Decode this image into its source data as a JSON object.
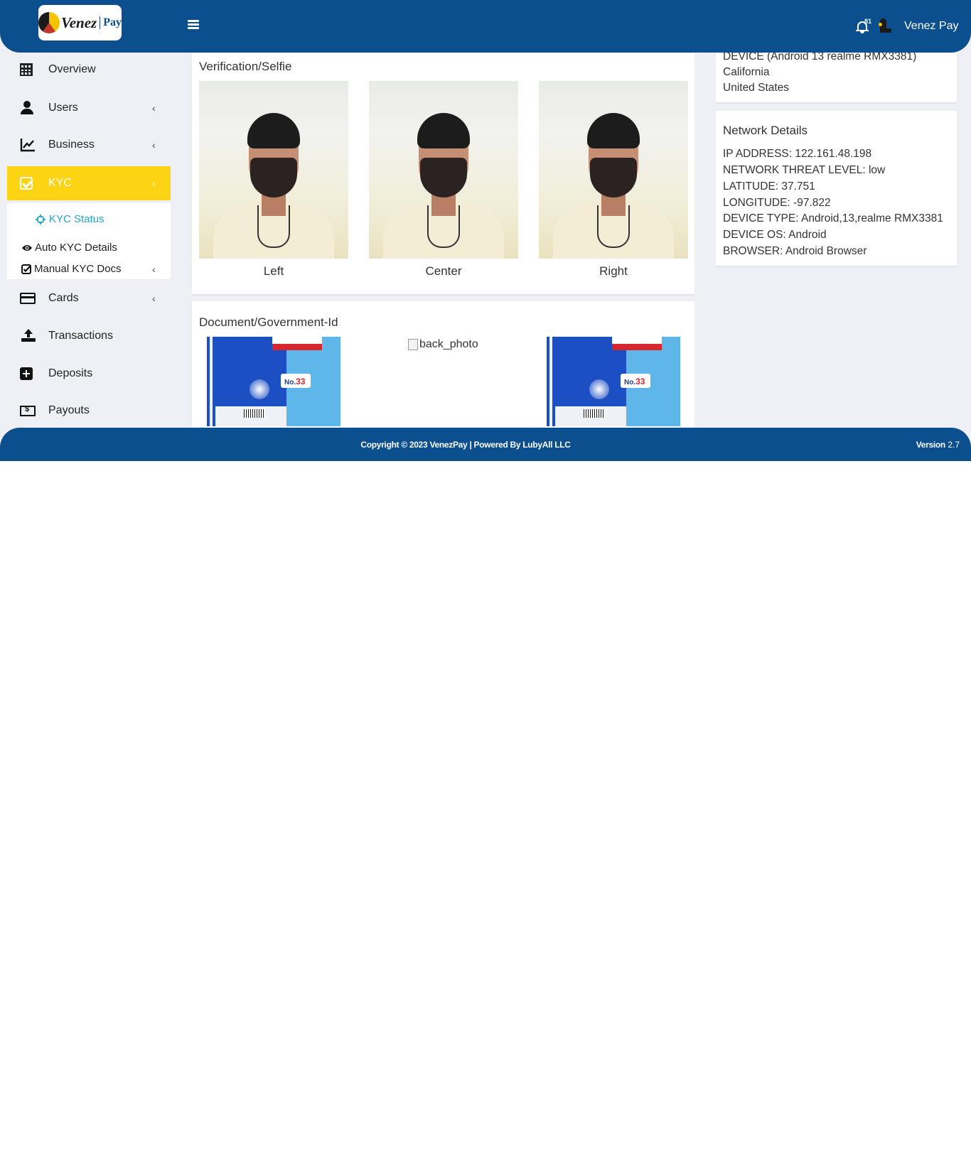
{
  "header": {
    "logo_word_1": "Venez",
    "logo_word_2": "Pay",
    "notification_count": "81",
    "username": "Venez Pay"
  },
  "sidebar": {
    "items": [
      {
        "label": "Overview",
        "icon": "calculator-icon"
      },
      {
        "label": "Users",
        "icon": "user-icon",
        "chevron": "‹"
      },
      {
        "label": "Business",
        "icon": "chart-line-icon",
        "chevron": "‹"
      },
      {
        "label": "KYC",
        "icon": "check-square-icon",
        "chevron": "‹",
        "active": true
      },
      {
        "label": "Cards",
        "icon": "credit-card-icon",
        "chevron": "‹"
      },
      {
        "label": "Transactions",
        "icon": "upload-icon"
      },
      {
        "label": "Deposits",
        "icon": "plus-square-icon"
      },
      {
        "label": "Payouts",
        "icon": "money-bill-icon"
      }
    ],
    "kyc_submenu": {
      "kyc_status": "KYC Status",
      "auto_kyc": "Auto KYC Details",
      "manual_kyc": "Manual KYC Docs",
      "chevron": "‹"
    }
  },
  "selfie": {
    "title": "Verification/Selfie",
    "labels": [
      "Left",
      "Center",
      "Right"
    ]
  },
  "document": {
    "title": "Document/Government-Id",
    "back_photo_alt": "back_photo",
    "stamp_no": "No.",
    "stamp_num": "33"
  },
  "device_card": {
    "lines": [
      "DEVICE (Android 13 realme RMX3381)",
      "California",
      "United States"
    ]
  },
  "network": {
    "title": "Network Details",
    "lines": [
      "IP ADDRESS: 122.161.48.198",
      "NETWORK THREAT LEVEL: low",
      "LATITUDE: 37.751",
      "LONGITUDE: -97.822",
      "DEVICE TYPE: Android,13,realme RMX3381",
      "DEVICE OS: Android",
      "BROWSER: Android Browser"
    ]
  },
  "footer": {
    "copyright": "Copyright © 2023  VenezPay  |  Powered By LubyAll LLC",
    "version_label": "Version",
    "version_number": "2.7"
  },
  "colors": {
    "brand_blue": "#0b4f8f",
    "kyc_active": "#fcd414",
    "submenu_link": "#21a8c5"
  }
}
